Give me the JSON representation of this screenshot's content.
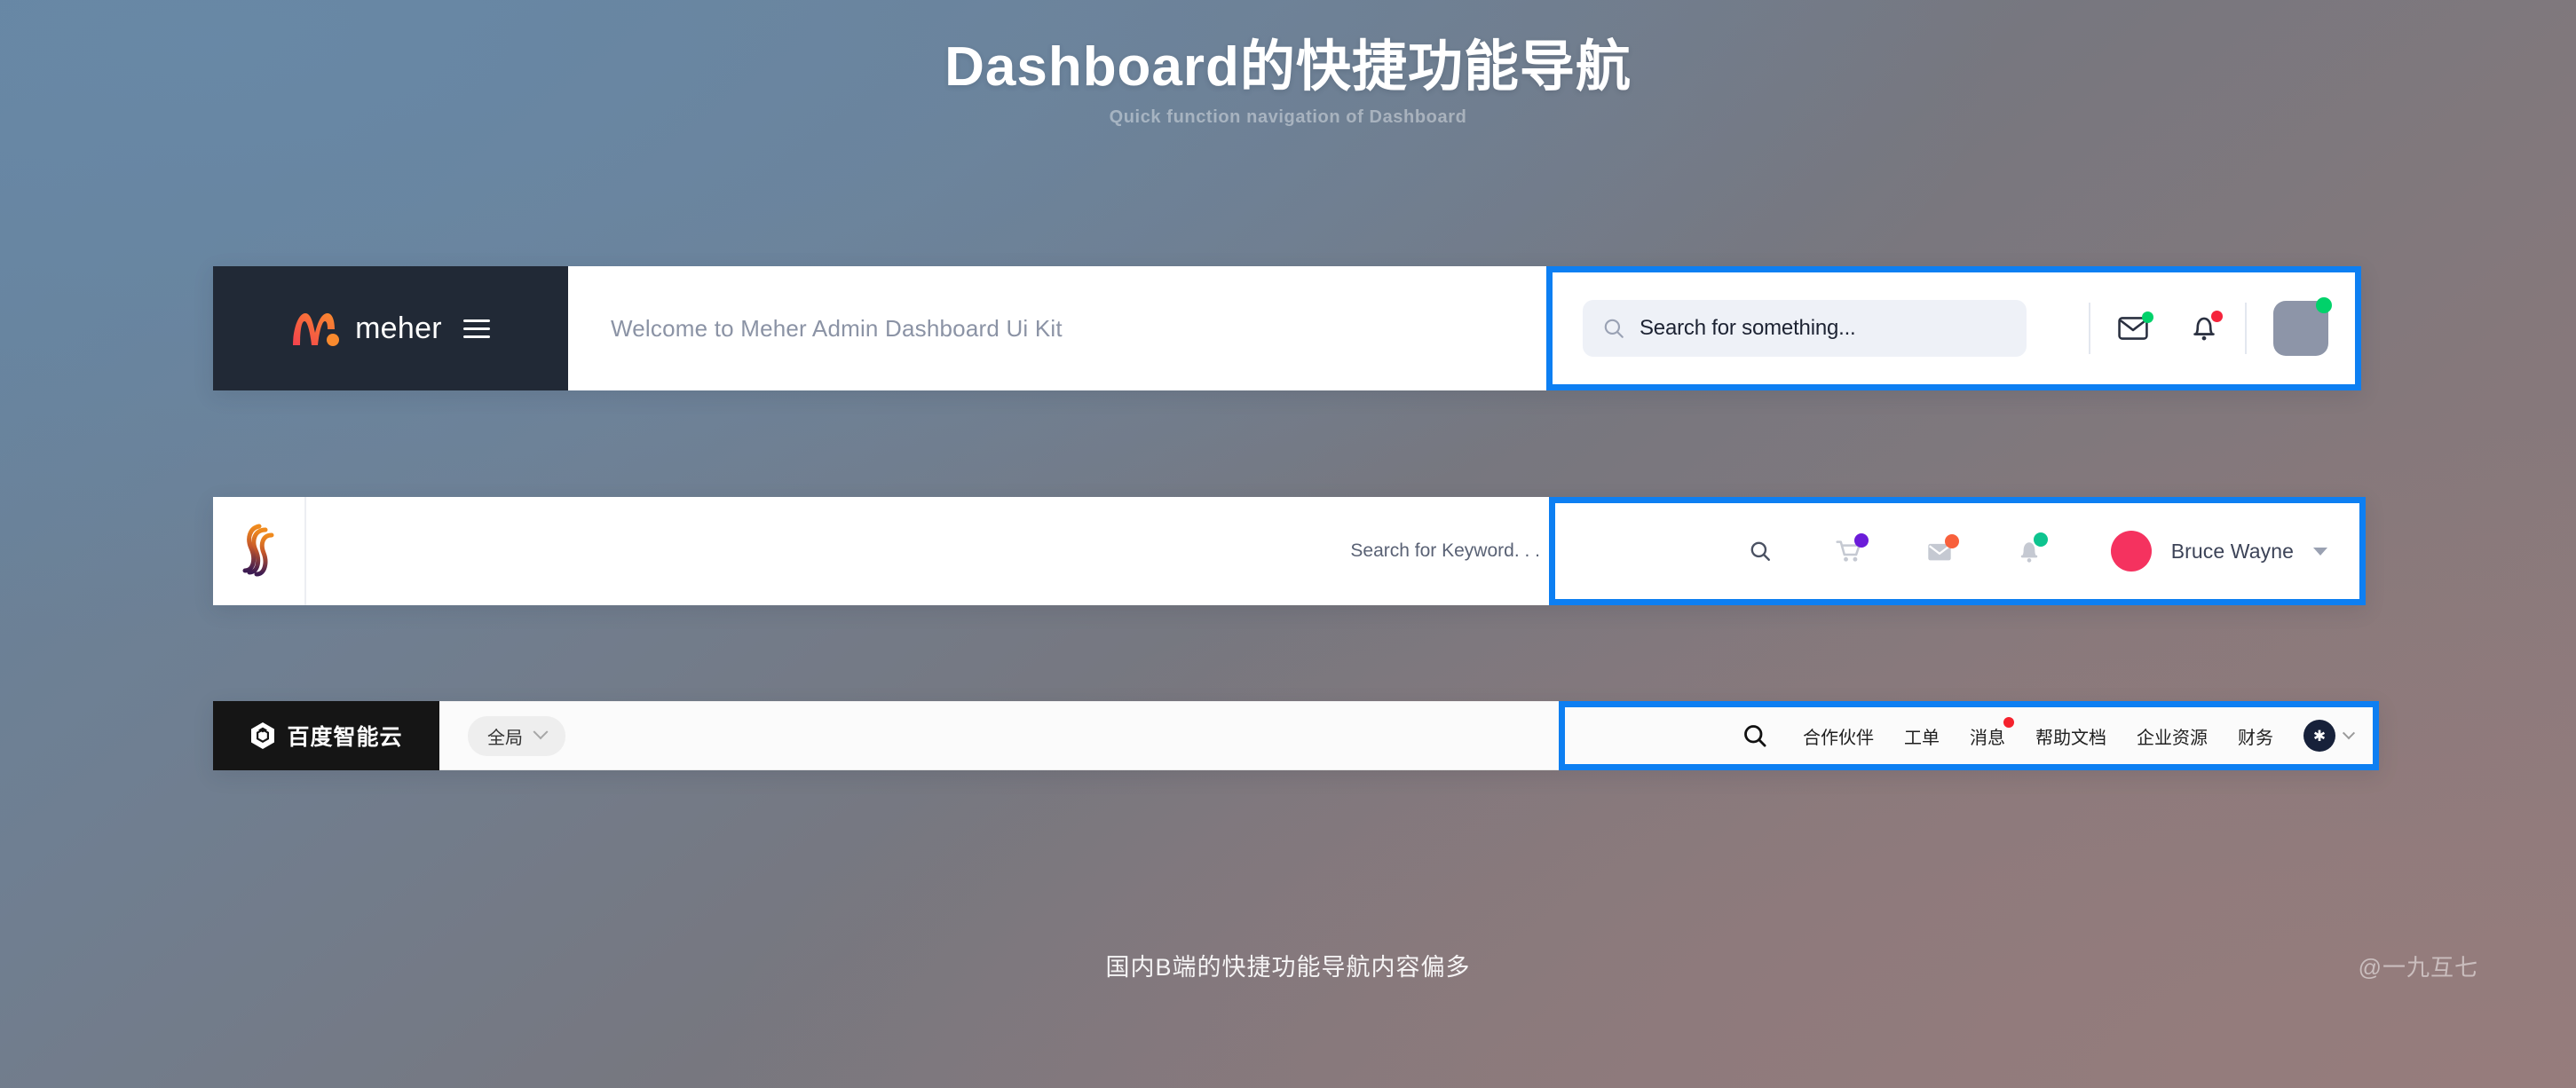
{
  "page": {
    "title": "Dashboard的快捷功能导航",
    "subtitle": "Quick function navigation of Dashboard",
    "caption": "国内B端的快捷功能导航内容偏多",
    "watermark": "@一九互七"
  },
  "colors": {
    "highlight_border": "#0d7ff2",
    "nav1_brand_bg": "#212936",
    "nav1_logo_gradient_from": "#f4414e",
    "nav1_logo_gradient_to": "#f98a2e",
    "nav2_avatar": "#f5325f",
    "nav2_badge_cart": "#6b1cd9",
    "nav2_badge_mail": "#f8603c",
    "nav2_badge_bell": "#0ec48f",
    "nav3_brand_bg": "#151515",
    "nav3_avatar": "#17213a",
    "badge_green": "#00d26a",
    "badge_red": "#f5243c"
  },
  "nav1": {
    "brand_name": "meher",
    "logo_icon": "meher-m-logo",
    "menu_icon": "hamburger-menu-icon",
    "welcome_text": "Welcome to Meher Admin Dashboard Ui Kit",
    "search": {
      "icon": "search-icon",
      "placeholder": "Search for something..."
    },
    "actions": [
      {
        "icon": "mail-icon",
        "badge": "green"
      },
      {
        "icon": "bell-icon",
        "badge": "red"
      }
    ],
    "avatar": {
      "icon": "user-avatar",
      "status": "online"
    }
  },
  "nav2": {
    "logo_icon": "serif-s-logo",
    "keyword_text": "Search for Keyword. . .",
    "icons": [
      {
        "icon": "search-icon",
        "badge": null
      },
      {
        "icon": "shopping-cart-icon",
        "badge": "purple"
      },
      {
        "icon": "mail-icon",
        "badge": "orange"
      },
      {
        "icon": "bell-icon",
        "badge": "teal"
      }
    ],
    "user": {
      "name": "Bruce Wayne",
      "avatar_icon": "user-avatar",
      "caret_icon": "caret-down-icon"
    }
  },
  "nav3": {
    "brand_name": "百度智能云",
    "brand_logo_icon": "baidu-cube-icon",
    "scope": {
      "label": "全局",
      "chevron_icon": "chevron-down-icon"
    },
    "search_icon": "search-icon",
    "items": [
      {
        "label": "合作伙伴",
        "badge": false
      },
      {
        "label": "工单",
        "badge": false
      },
      {
        "label": "消息",
        "badge": true
      },
      {
        "label": "帮助文档",
        "badge": false
      },
      {
        "label": "企业资源",
        "badge": false
      },
      {
        "label": "财务",
        "badge": false
      }
    ],
    "avatar": {
      "glyph": "✱",
      "chevron_icon": "chevron-down-icon"
    }
  }
}
